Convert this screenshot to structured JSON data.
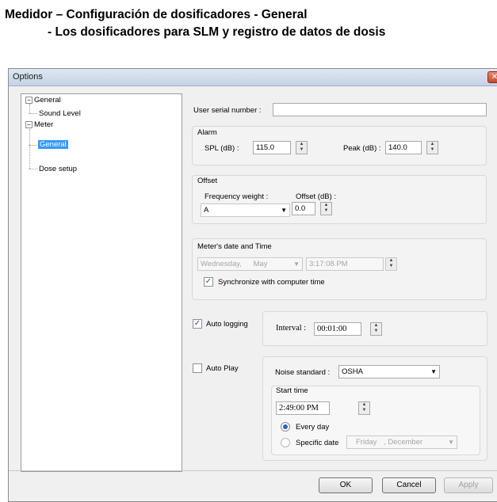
{
  "document": {
    "title_line1": "Medidor – Configuración de dosificadores - General",
    "title_line2": "- Los dosificadores para SLM y registro de datos de dosis"
  },
  "window": {
    "title": "Options",
    "close_glyph": "✕"
  },
  "tree": {
    "general": "General",
    "sound_level": "Sound Level",
    "meter": "Meter",
    "meter_general": "General",
    "dose_setup": "Dose setup",
    "collapse_glyph": "−"
  },
  "serial": {
    "label": "User serial number :",
    "value": ""
  },
  "alarm": {
    "title": "Alarm",
    "spl_label": "SPL (dB) :",
    "spl_value": "115.0",
    "peak_label": "Peak (dB) :",
    "peak_value": "140.0"
  },
  "offset": {
    "title": "Offset",
    "freq_label": "Frequency weight :",
    "freq_value": "A",
    "offset_label": "Offset (dB) :",
    "offset_value": "0.0"
  },
  "datetime": {
    "title": "Meter's date and Time",
    "day": "Wednesday,",
    "month": "May",
    "time": "3:17:08 PM",
    "sync_label": "Synchronize with computer time",
    "sync_checked": true
  },
  "logging": {
    "label": "Auto logging",
    "checked": true,
    "interval_label": "Interval :",
    "interval_value": "00:01:00"
  },
  "autoplay": {
    "label": "Auto Play",
    "checked": false,
    "noise_label": "Noise standard :",
    "noise_value": "OSHA",
    "start_time_title": "Start time",
    "start_time_value": "2:49:00 PM",
    "every_day_label": "Every day",
    "specific_date_label": "Specific date",
    "date_day": "Friday",
    "date_month": ", December",
    "selected": "every_day"
  },
  "buttons": {
    "ok": "OK",
    "cancel": "Cancel",
    "apply": "Apply"
  },
  "glyphs": {
    "spin_up": "▲",
    "spin_down": "▼",
    "dropdown": "▼",
    "check": "✓"
  }
}
